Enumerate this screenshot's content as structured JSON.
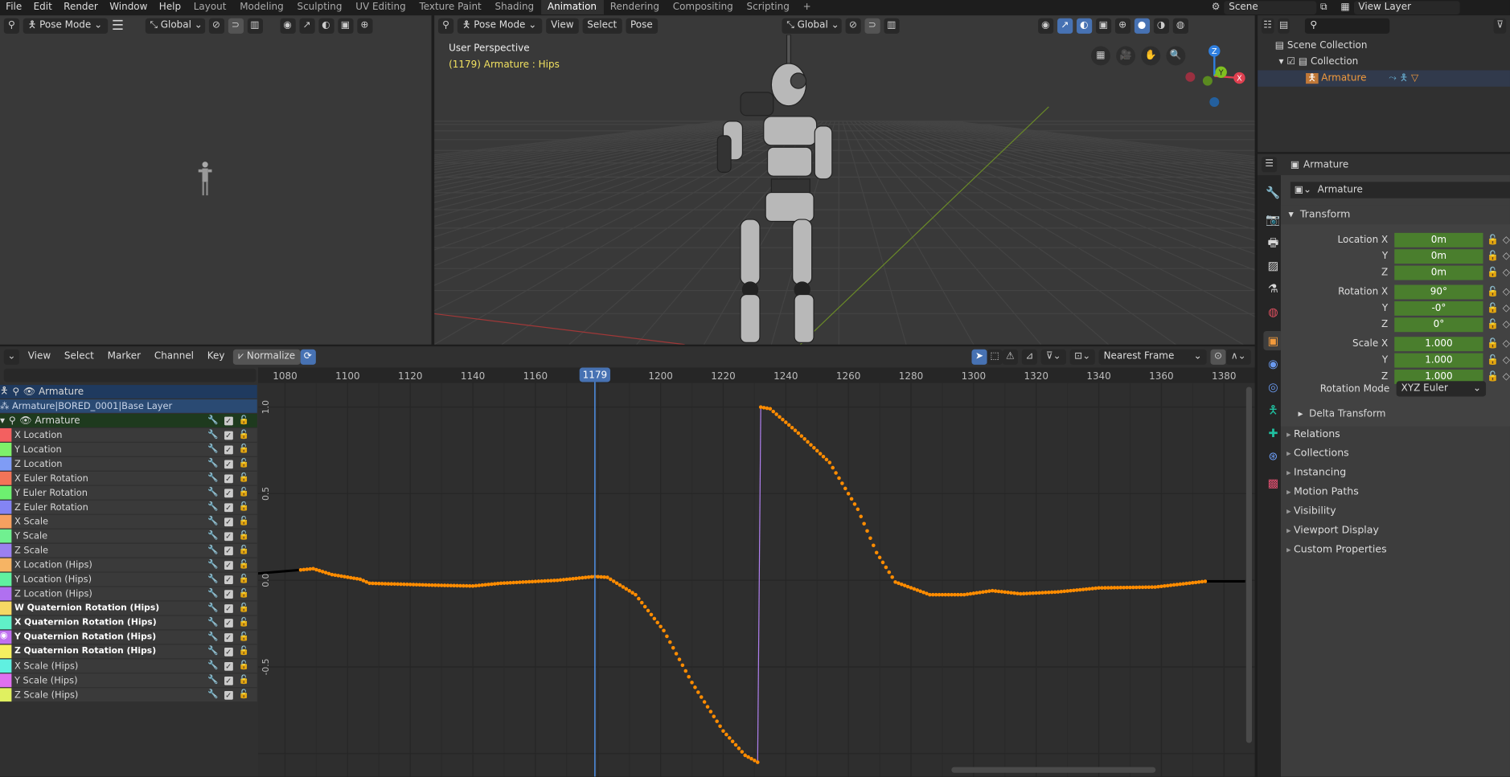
{
  "menu": [
    "File",
    "Edit",
    "Render",
    "Window",
    "Help"
  ],
  "workspaces": [
    {
      "label": "Layout"
    },
    {
      "label": "Modeling"
    },
    {
      "label": "Sculpting"
    },
    {
      "label": "UV Editing"
    },
    {
      "label": "Texture Paint"
    },
    {
      "label": "Shading"
    },
    {
      "label": "Animation",
      "active": true
    },
    {
      "label": "Rendering"
    },
    {
      "label": "Compositing"
    },
    {
      "label": "Scripting"
    },
    {
      "label": "+"
    }
  ],
  "scene": {
    "name": "Scene",
    "view_layer": "View Layer"
  },
  "left_viewport": {
    "mode": "Pose Mode",
    "orientation": "Global"
  },
  "main_viewport": {
    "mode": "Pose Mode",
    "menus": [
      "View",
      "Select",
      "Pose"
    ],
    "orientation": "Global",
    "perspective": "User Perspective",
    "info": "(1179) Armature : Hips",
    "axes": {
      "x": "X",
      "y": "Y",
      "z": "Z"
    }
  },
  "outliner": {
    "search_placeholder": "",
    "items": [
      {
        "label": "Scene Collection"
      },
      {
        "label": "Collection"
      },
      {
        "label": "Armature"
      }
    ]
  },
  "properties": {
    "header": "Armature",
    "object_name": "Armature",
    "transform_title": "Transform",
    "rows": [
      {
        "label": "Location X",
        "value": "0m"
      },
      {
        "label": "Y",
        "value": "0m"
      },
      {
        "label": "Z",
        "value": "0m"
      },
      {
        "label": "Rotation X",
        "value": "90°"
      },
      {
        "label": "Y",
        "value": "-0°"
      },
      {
        "label": "Z",
        "value": "0°"
      },
      {
        "label": "Scale X",
        "value": "1.000"
      },
      {
        "label": "Y",
        "value": "1.000"
      },
      {
        "label": "Z",
        "value": "1.000"
      }
    ],
    "rotation_mode_label": "Rotation Mode",
    "rotation_mode": "XYZ Euler",
    "delta": "Delta Transform",
    "sections": [
      "Relations",
      "Collections",
      "Instancing",
      "Motion Paths",
      "Visibility",
      "Viewport Display",
      "Custom Properties"
    ]
  },
  "graph_editor": {
    "menus": [
      "View",
      "Select",
      "Marker",
      "Channel",
      "Key"
    ],
    "normalize": "Normalize",
    "snap": "Nearest Frame",
    "current_frame": "1179",
    "frame_ticks": [
      "1080",
      "1100",
      "1120",
      "1140",
      "1160",
      "1180",
      "1200",
      "1220",
      "1240",
      "1260",
      "1280",
      "1300",
      "1320",
      "1340",
      "1360",
      "1380"
    ],
    "value_ticks": [
      "1.0",
      "0.5",
      "0.0",
      "-0.5"
    ],
    "object": "Armature",
    "action": "Armature|BORED_0001|Base Layer",
    "group": "Armature",
    "channels": [
      {
        "name": "X Location",
        "color": "#f36060"
      },
      {
        "name": "Y Location",
        "color": "#7ef06a"
      },
      {
        "name": "Z Location",
        "color": "#7f9cf5"
      },
      {
        "name": "X Euler Rotation",
        "color": "#f37458"
      },
      {
        "name": "Y Euler Rotation",
        "color": "#6df070"
      },
      {
        "name": "Z Euler Rotation",
        "color": "#8484f3"
      },
      {
        "name": "X Scale",
        "color": "#f6a060"
      },
      {
        "name": "Y Scale",
        "color": "#70f090"
      },
      {
        "name": "Z Scale",
        "color": "#9b80f0"
      },
      {
        "name": "X Location (Hips)",
        "color": "#f6b464"
      },
      {
        "name": "Y Location (Hips)",
        "color": "#60f0a0"
      },
      {
        "name": "Z Location (Hips)",
        "color": "#b070f0"
      },
      {
        "name": "W Quaternion Rotation (Hips)",
        "color": "#f6d864",
        "bold": true
      },
      {
        "name": "X Quaternion Rotation (Hips)",
        "color": "#60f0c8",
        "bold": true
      },
      {
        "name": "Y Quaternion Rotation (Hips)",
        "color": "#c070f0",
        "bold": true,
        "visible": true
      },
      {
        "name": "Z Quaternion Rotation (Hips)",
        "color": "#f6f060",
        "bold": true
      },
      {
        "name": "X Scale (Hips)",
        "color": "#60f0e0"
      },
      {
        "name": "Y Scale (Hips)",
        "color": "#e070f0"
      },
      {
        "name": "Z Scale (Hips)",
        "color": "#e0f060"
      }
    ],
    "curve": {
      "channel": "Y Quaternion Rotation (Hips)",
      "color": "#ff8c00",
      "frame_range": [
        1085,
        1374
      ],
      "keys": [
        [
          1085,
          0.06
        ],
        [
          1089,
          0.067
        ],
        [
          1095,
          0.033
        ],
        [
          1104,
          0.006
        ],
        [
          1107,
          -0.017
        ],
        [
          1127,
          -0.028
        ],
        [
          1140,
          -0.033
        ],
        [
          1149,
          -0.017
        ],
        [
          1167,
          0
        ],
        [
          1179,
          0.022
        ],
        [
          1183,
          0.017
        ],
        [
          1192,
          -0.083
        ],
        [
          1201,
          -0.29
        ],
        [
          1210,
          -0.59
        ],
        [
          1220,
          -0.87
        ],
        [
          1227,
          -1.01
        ],
        [
          1231,
          -1.05
        ],
        [
          1232,
          1.0
        ],
        [
          1235,
          0.99
        ],
        [
          1244,
          0.85
        ],
        [
          1254,
          0.68
        ],
        [
          1263,
          0.41
        ],
        [
          1269,
          0.16
        ],
        [
          1275,
          -0.01
        ],
        [
          1286,
          -0.083
        ],
        [
          1297,
          -0.083
        ],
        [
          1306,
          -0.06
        ],
        [
          1315,
          -0.078
        ],
        [
          1327,
          -0.067
        ],
        [
          1340,
          -0.044
        ],
        [
          1358,
          -0.039
        ],
        [
          1374,
          -0.006
        ]
      ],
      "extrapolation_left": [
        [
          1071,
          0.04
        ],
        [
          1085,
          0.06
        ]
      ]
    }
  }
}
